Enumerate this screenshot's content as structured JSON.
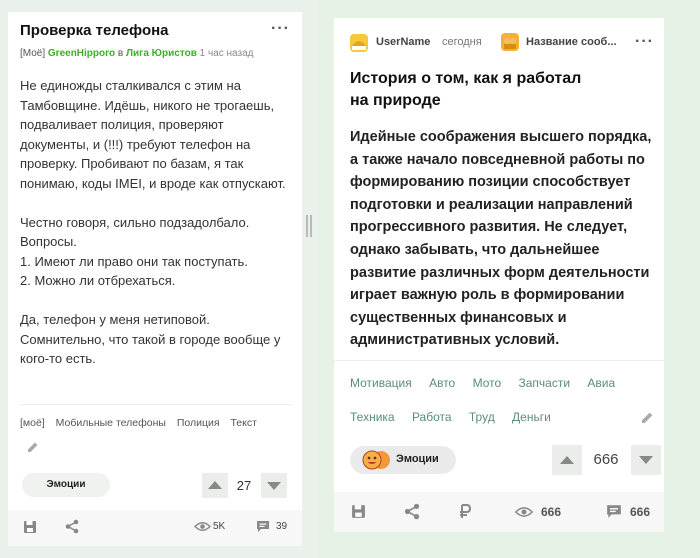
{
  "left_post": {
    "title": "Проверка телефона",
    "menu_icon": "more-dots-icon",
    "meta": {
      "tag": "[Моё]",
      "author": "GreenHipporo",
      "in_word": "в",
      "community": "Лига Юристов",
      "time": "1 час назад"
    },
    "paragraphs": [
      "Не единожды сталкивался с этим на Тамбовщине. Идёшь, никого не трогаешь, подваливает полиция, проверяют документы, и (!!!) требуют телефон на проверку. Пробивают по базам, я так понимаю, коды IMEI, и вроде как отпускают.",
      "Честно говоря, сильно подзадолбало. Вопросы.\n1. Имеют ли право они так поступать.\n2. Можно ли отбрехаться.",
      "Да, телефон у меня нетиповой. Сомнительно, что такой в городе вообще у кого-то есть."
    ],
    "tags": [
      "[моё]",
      "Мобильные телефоны",
      "Полиция",
      "Текст"
    ],
    "emotions_label": "Эмоции",
    "rating": "27",
    "footer": {
      "views": "5K",
      "comments": "39"
    }
  },
  "right_post": {
    "username": "UserName",
    "time": "сегодня",
    "community": "Название сооб...",
    "menu_icon": "more-dots-icon",
    "title": "История о том, как я работал на природе",
    "body": "Идейные соображения высшего порядка, а также начало повседневной работы по формированию позиции способствует подготовки и реализации направлений прогрессивного развития. Не следует, однако забывать, что дальнейшее развитие различных форм деятельности играет важную роль в формировании существенных финансовых и административных условий.",
    "tags_row1": [
      "Мотивация",
      "Авто",
      "Мото",
      "Запчасти",
      "Авиа"
    ],
    "tags_row2": [
      "Техника",
      "Работа",
      "Труд",
      "Деньги"
    ],
    "emotions_label": "Эмоции",
    "rating": "666",
    "footer": {
      "views": "666",
      "comments": "666"
    }
  },
  "colors": {
    "accent_green": "#3fae2a",
    "tag_teal": "#5a8d7a",
    "bg_right": "#e6f2e6"
  }
}
